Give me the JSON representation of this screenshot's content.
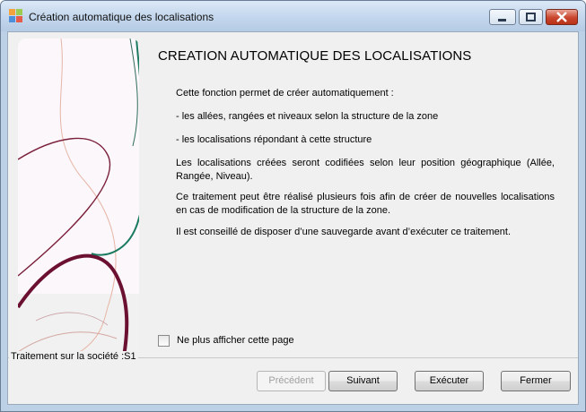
{
  "window": {
    "title": "Création automatique des localisations"
  },
  "content": {
    "heading": "CREATION AUTOMATIQUE DES LOCALISATIONS",
    "paragraphs": [
      "Cette fonction permet de créer automatiquement :",
      "- les allées, rangées et niveaux selon la structure de la zone",
      "- les localisations répondant à cette structure",
      "Les localisations créées seront codifiées selon leur position géographique (Allée, Rangée, Niveau).",
      "Ce traitement peut être réalisé plusieurs fois afin de créer de nouvelles localisations en cas de modification de la structure de la zone.",
      "Il est conseillé de disposer d’une sauvegarde avant d’exécuter ce traitement."
    ],
    "checkbox_label": "Ne plus afficher cette page",
    "checkbox_checked": false
  },
  "status": {
    "text": "Traitement sur la société :S1"
  },
  "buttons": {
    "previous": "Précédent",
    "next": "Suivant",
    "execute": "Exécuter",
    "close": "Fermer"
  },
  "colors": {
    "title_bar": "#c3d6ec",
    "dialog_bg": "#f0f0f0",
    "art_wine": "#6b1030",
    "art_teal": "#1b7a60",
    "close_button": "#c9452d"
  }
}
